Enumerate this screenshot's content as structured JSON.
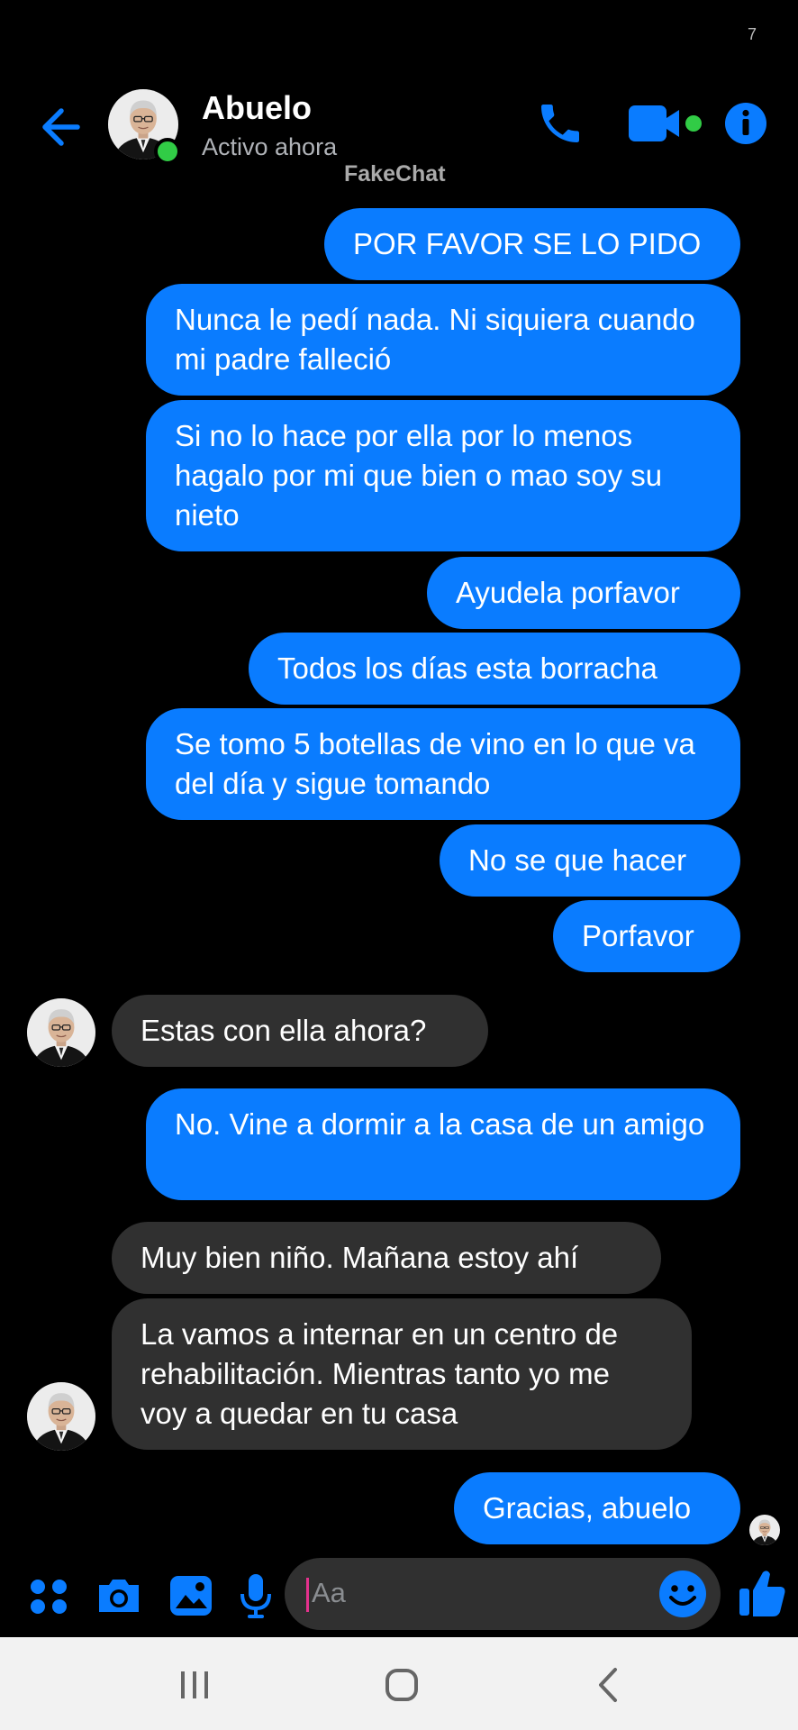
{
  "status_bar": {
    "indicator": "7"
  },
  "header": {
    "name": "Abuelo",
    "status": "Activo ahora",
    "watermark": "FakeChat",
    "icons": {
      "back": "arrow-left-icon",
      "call": "phone-icon",
      "video": "video-camera-icon",
      "info": "info-icon"
    }
  },
  "messages": [
    {
      "from": "me",
      "text": "POR FAVOR SE LO PIDO"
    },
    {
      "from": "me",
      "text": "Nunca le pedí nada. Ni siquiera cuando mi padre falleció"
    },
    {
      "from": "me",
      "text": "Si no lo hace por ella por lo menos hagalo por mi que bien o mao soy su nieto"
    },
    {
      "from": "me",
      "text": "Ayudela porfavor"
    },
    {
      "from": "me",
      "text": "Todos los días esta borracha"
    },
    {
      "from": "me",
      "text": "Se tomo 5 botellas de vino en lo que va del día y sigue tomando"
    },
    {
      "from": "me",
      "text": "No se que hacer"
    },
    {
      "from": "me",
      "text": "Porfavor"
    },
    {
      "from": "them",
      "text": "Estas con ella ahora?"
    },
    {
      "from": "me",
      "text": "No. Vine a dormir a la casa de un amigo"
    },
    {
      "from": "them",
      "text": "Muy bien niño. Mañana estoy ahí"
    },
    {
      "from": "them",
      "text": "La vamos a internar en un centro de rehabilitación. Mientras tanto yo me voy a quedar en tu casa"
    },
    {
      "from": "me",
      "text": "Gracias, abuelo"
    }
  ],
  "composer": {
    "placeholder": "Aa",
    "icons": [
      "menu-dots-icon",
      "camera-icon",
      "gallery-icon",
      "microphone-icon",
      "emoji-icon",
      "thumbs-up-icon"
    ]
  },
  "navbar": {
    "icons": [
      "recent-apps-icon",
      "home-icon",
      "back-icon"
    ]
  },
  "colors": {
    "accent": "#0a7cff",
    "online": "#31cc46",
    "received_bubble": "#303030",
    "background": "#000000"
  }
}
